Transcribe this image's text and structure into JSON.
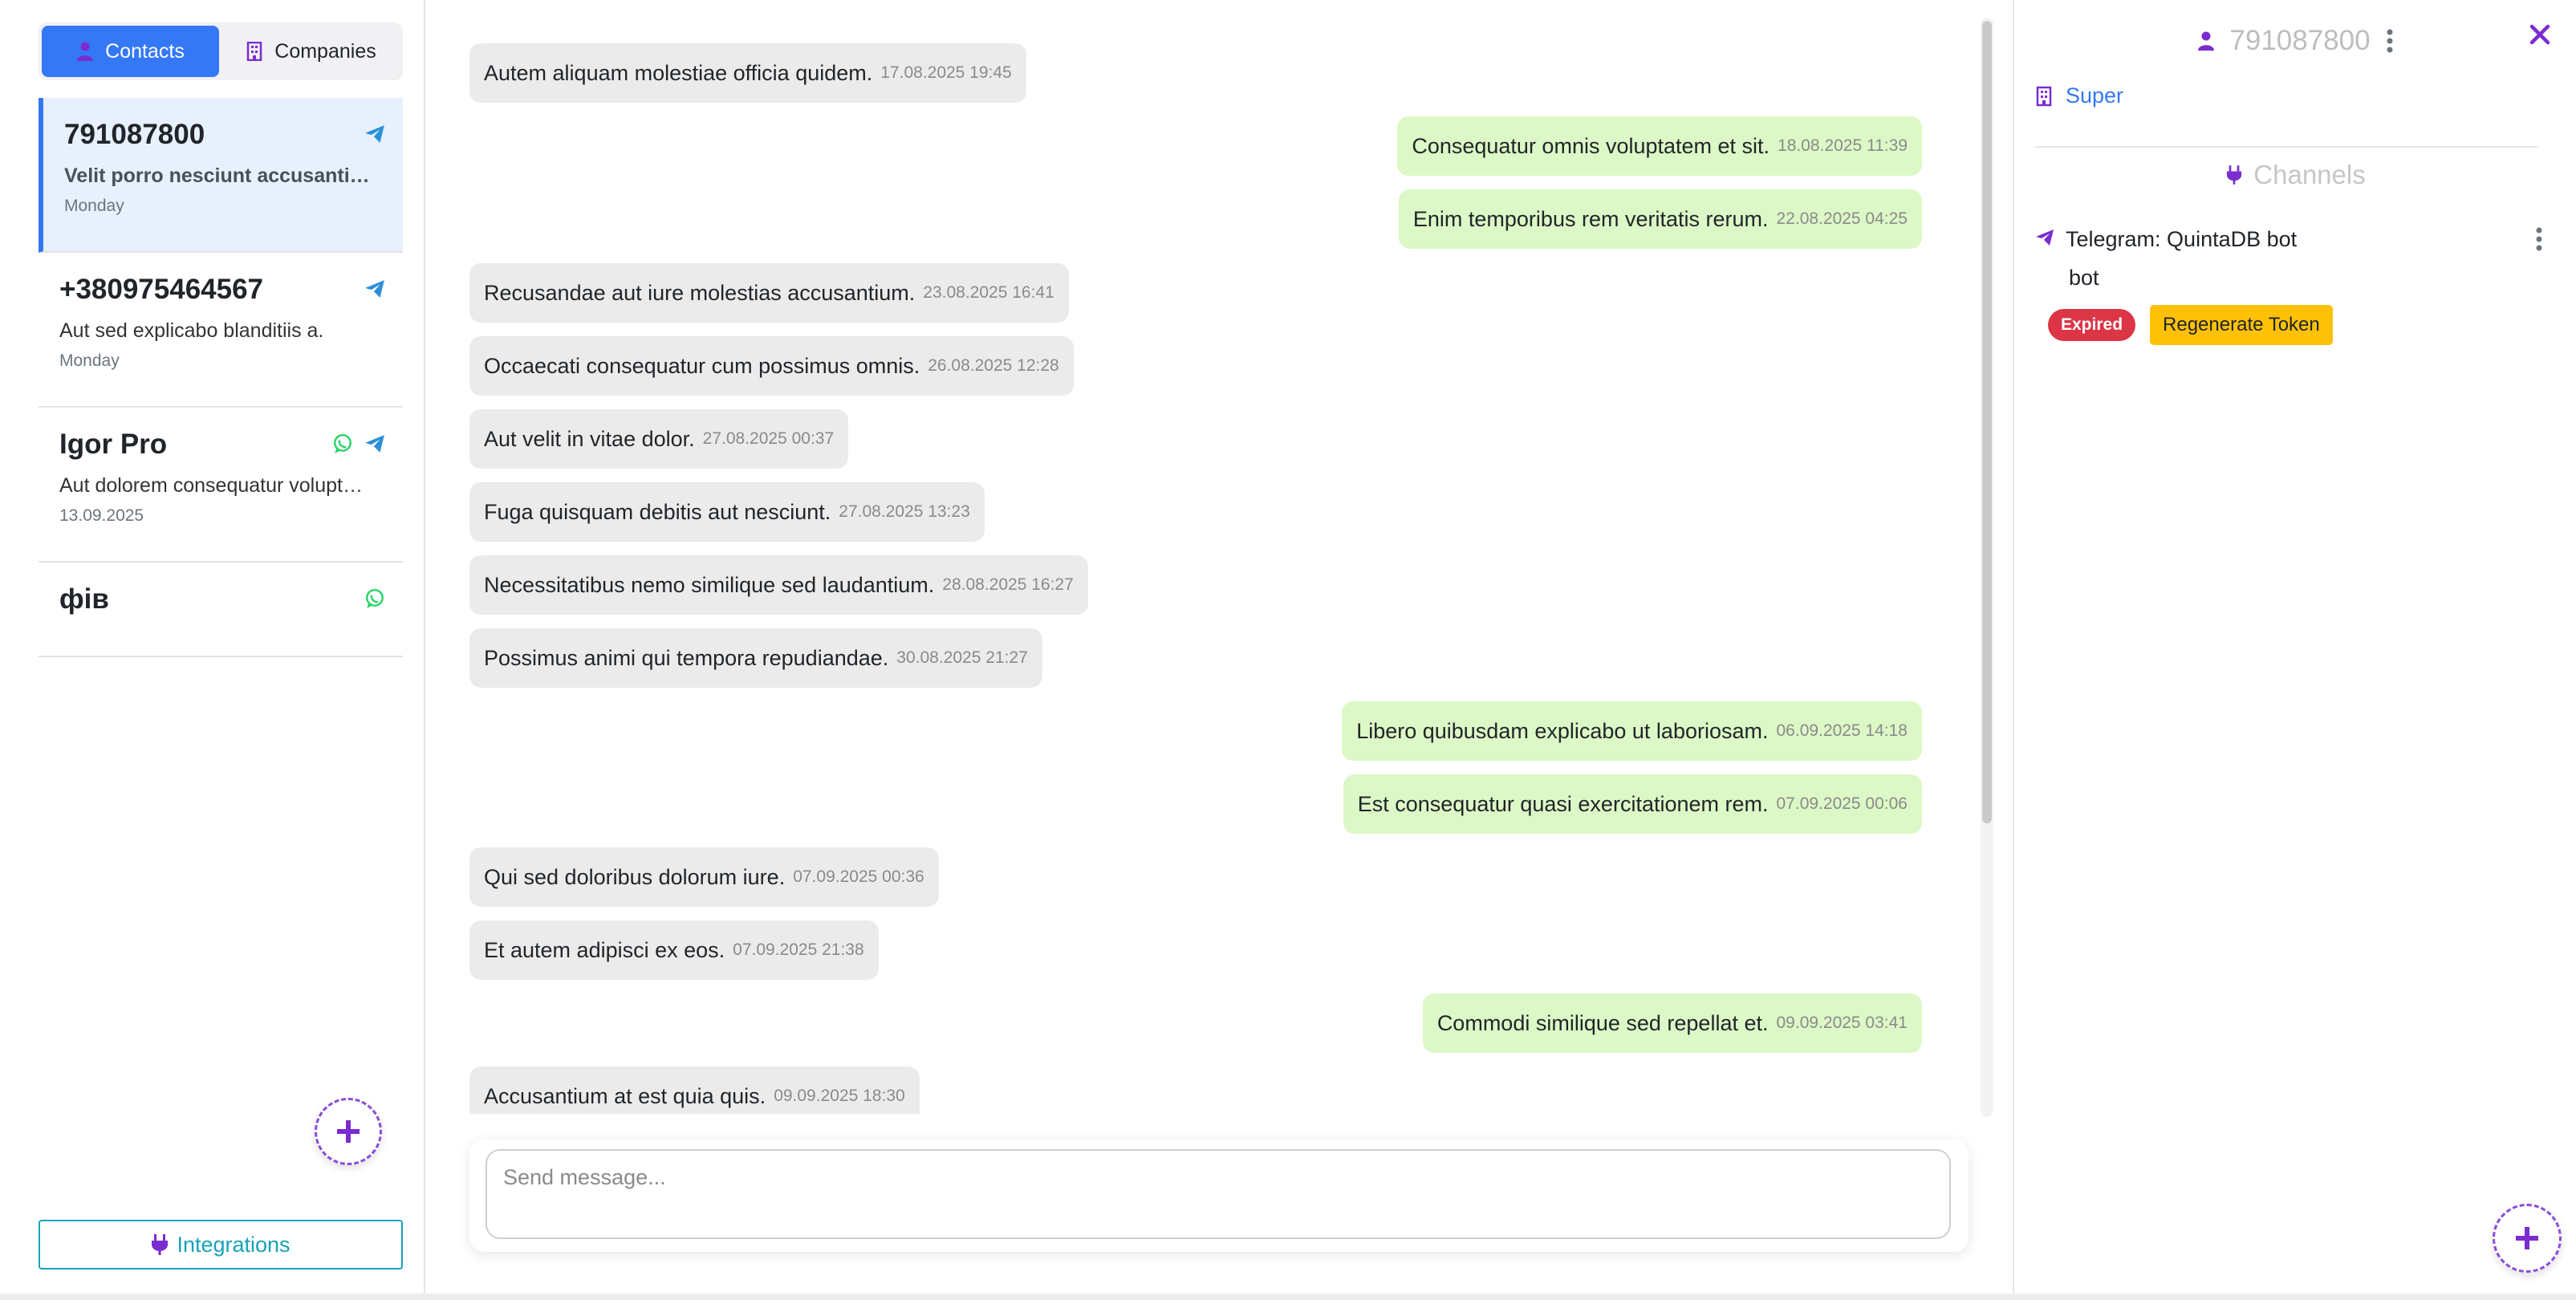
{
  "colors": {
    "primary": "#3478f6",
    "purple": "#7b2ccf",
    "telegram": "#2b8fd8",
    "whatsapp": "#25d366",
    "incoming_bubble": "#ebebeb",
    "outgoing_bubble": "#dcf8c6",
    "expired": "#dc3545",
    "warning": "#ffc107",
    "info": "#17a2b8"
  },
  "tabs": [
    {
      "label": "Contacts",
      "icon": "person-icon",
      "active": true
    },
    {
      "label": "Companies",
      "icon": "building-icon",
      "active": false
    }
  ],
  "contacts": [
    {
      "name": "791087800",
      "preview": "Velit porro nesciunt accusantium.",
      "date": "Monday",
      "channels": [
        "telegram"
      ],
      "selected": true
    },
    {
      "name": "+380975464567",
      "preview": "Aut sed explicabo blanditiis a.",
      "date": "Monday",
      "channels": [
        "telegram"
      ],
      "selected": false
    },
    {
      "name": "Igor Pro",
      "preview": "Aut dolorem consequatur voluptatem.",
      "date": "13.09.2025",
      "channels": [
        "whatsapp",
        "telegram"
      ],
      "selected": false
    },
    {
      "name": "фів",
      "preview": "",
      "date": "",
      "channels": [
        "whatsapp"
      ],
      "selected": false
    }
  ],
  "integrations_label": "Integrations",
  "messages": [
    {
      "dir": "in",
      "text": "Autem aliquam molestiae officia quidem.",
      "time": "17.08.2025 19:45"
    },
    {
      "dir": "out",
      "text": "Consequatur omnis voluptatem et sit.",
      "time": "18.08.2025 11:39"
    },
    {
      "dir": "out",
      "text": "Enim temporibus rem veritatis rerum.",
      "time": "22.08.2025 04:25"
    },
    {
      "dir": "in",
      "text": "Recusandae aut iure molestias accusantium.",
      "time": "23.08.2025 16:41"
    },
    {
      "dir": "in",
      "text": "Occaecati consequatur cum possimus omnis.",
      "time": "26.08.2025 12:28"
    },
    {
      "dir": "in",
      "text": "Aut velit in vitae dolor.",
      "time": "27.08.2025 00:37"
    },
    {
      "dir": "in",
      "text": "Fuga quisquam debitis aut nesciunt.",
      "time": "27.08.2025 13:23"
    },
    {
      "dir": "in",
      "text": "Necessitatibus nemo similique sed laudantium.",
      "time": "28.08.2025 16:27"
    },
    {
      "dir": "in",
      "text": "Possimus animi qui tempora repudiandae.",
      "time": "30.08.2025 21:27"
    },
    {
      "dir": "out",
      "text": "Libero quibusdam explicabo ut laboriosam.",
      "time": "06.09.2025 14:18"
    },
    {
      "dir": "out",
      "text": "Est consequatur quasi exercitationem rem.",
      "time": "07.09.2025 00:06"
    },
    {
      "dir": "in",
      "text": "Qui sed doloribus dolorum iure.",
      "time": "07.09.2025 00:36"
    },
    {
      "dir": "in",
      "text": "Et autem adipisci ex eos.",
      "time": "07.09.2025 21:38"
    },
    {
      "dir": "out",
      "text": "Commodi similique sed repellat et.",
      "time": "09.09.2025 03:41"
    },
    {
      "dir": "in",
      "text": "Accusantium at est quia quis.",
      "time": "09.09.2025 18:30"
    }
  ],
  "composer": {
    "placeholder": "Send message..."
  },
  "right_panel": {
    "title": "791087800",
    "company": "Super",
    "channels_title": "Channels",
    "channel": {
      "name_line1": "Telegram: QuintaDB bot",
      "name_line2": "bot",
      "status": "Expired",
      "action_label": "Regenerate Token"
    }
  }
}
